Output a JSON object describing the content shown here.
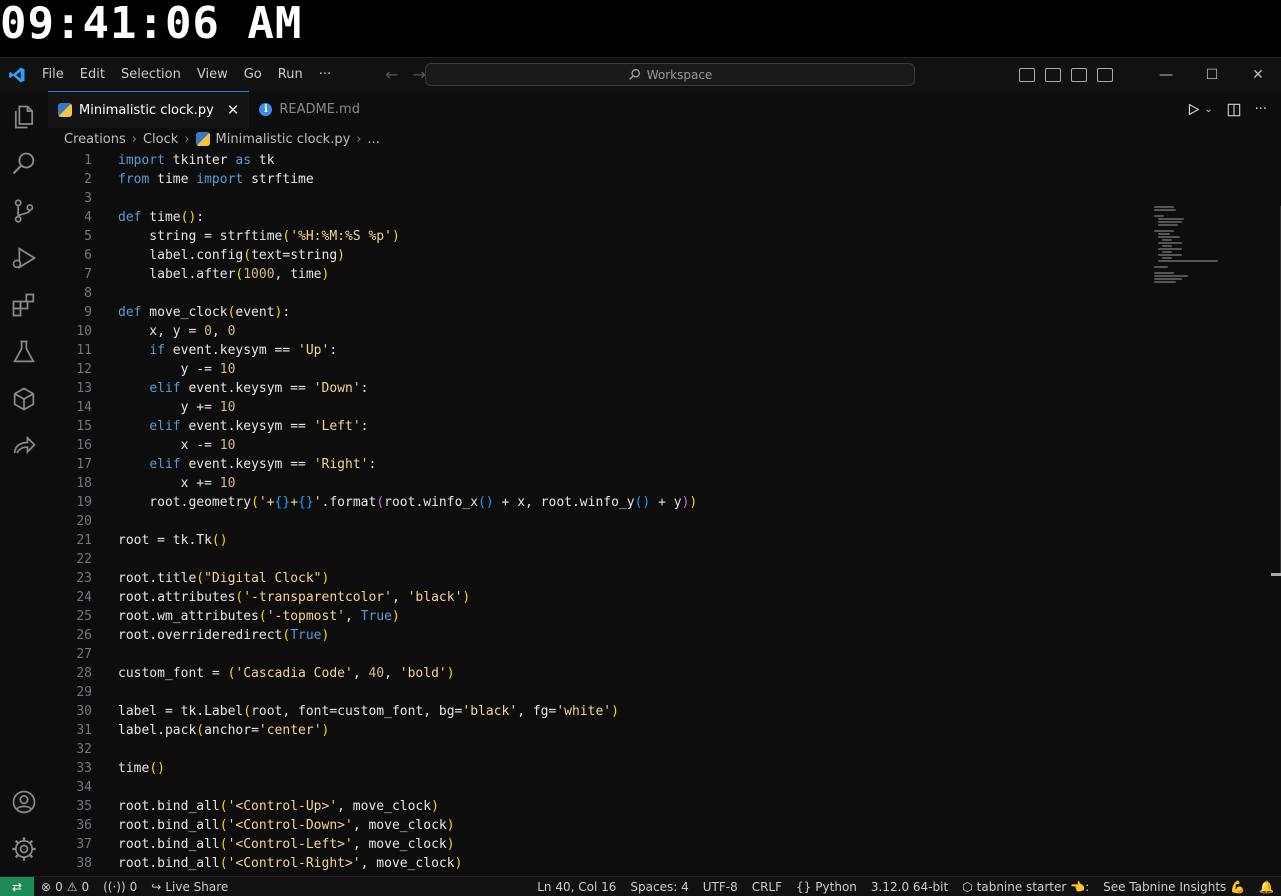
{
  "clock": {
    "time": "09:41:06 AM"
  },
  "menu": [
    "File",
    "Edit",
    "Selection",
    "View",
    "Go",
    "Run",
    "···"
  ],
  "search": {
    "label": "Workspace"
  },
  "tabs": [
    {
      "label": "Minimalistic clock.py",
      "active": true
    },
    {
      "label": "README.md",
      "active": false
    }
  ],
  "breadcrumb": [
    "Creations",
    "Clock",
    "Minimalistic clock.py",
    "..."
  ],
  "code": [
    "1",
    "2",
    "3",
    "4",
    "5",
    "6",
    "7",
    "8",
    "9",
    "10",
    "11",
    "12",
    "13",
    "14",
    "15",
    "16",
    "17",
    "18",
    "19",
    "20",
    "21",
    "22",
    "23",
    "24",
    "25",
    "26",
    "27",
    "28",
    "29",
    "30",
    "31",
    "32",
    "33",
    "34",
    "35",
    "36",
    "37",
    "38"
  ],
  "status": {
    "problems_errors": "0",
    "problems_warnings": "0",
    "ports": "0",
    "live_share": "Live Share",
    "position": "Ln 40, Col 16",
    "spaces": "Spaces: 4",
    "encoding": "UTF-8",
    "eol": "CRLF",
    "language": "Python",
    "interpreter": "3.12.0 64-bit",
    "tabnine": "tabnine starter 👈:",
    "insights": "See Tabnine Insights 💪"
  },
  "colors": {
    "accent": "#2b7bd6",
    "remote": "#1f8a5a"
  }
}
